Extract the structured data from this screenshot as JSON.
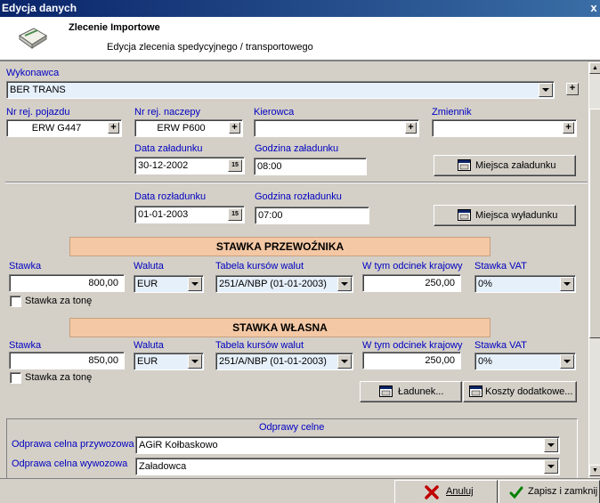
{
  "window": {
    "title": "Edycja danych",
    "close_glyph": "x"
  },
  "header": {
    "title": "Zlecenie Importowe",
    "subtitle": "Edycja zlecenia spedycyjnego / transportowego",
    "icon": "envelope-icon"
  },
  "wykonawca": {
    "label": "Wykonawca",
    "value": "BER TRANS"
  },
  "vehicle": {
    "nr_rej_pojazdu_label": "Nr rej. pojazdu",
    "nr_rej_pojazdu": "ERW G447",
    "nr_rej_naczepy_label": "Nr rej. naczepy",
    "nr_rej_naczepy": "ERW P600",
    "kierowca_label": "Kierowca",
    "kierowca": "",
    "zmiennik_label": "Zmiennik",
    "zmiennik": ""
  },
  "zaladunek": {
    "data_label": "Data załadunku",
    "data": "30-12-2002",
    "godzina_label": "Godzina załadunku",
    "godzina": "08:00",
    "button": "Miejsca załadunku"
  },
  "rozladunek": {
    "data_label": "Data rozładunku",
    "data": "01-01-2003",
    "godzina_label": "Godzina rozładunku",
    "godzina": "07:00",
    "button": "Miejsca wyładunku"
  },
  "calendar_glyph": "15",
  "plus_glyph": "+",
  "stawka_przewoznika": {
    "title": "STAWKA PRZEWOŹNIKA",
    "stawka_label": "Stawka",
    "stawka": "800,00",
    "waluta_label": "Waluta",
    "waluta": "EUR",
    "tabela_label": "Tabela kursów walut",
    "tabela": "251/A/NBP (01-01-2003)",
    "odcinek_label": "W tym odcinek krajowy",
    "odcinek": "250,00",
    "vat_label": "Stawka VAT",
    "vat": "0%",
    "za_tone_label": "Stawka za tonę"
  },
  "stawka_wlasna": {
    "title": "STAWKA WŁASNA",
    "stawka_label": "Stawka",
    "stawka": "850,00",
    "waluta_label": "Waluta",
    "waluta": "EUR",
    "tabela_label": "Tabela kursów walut",
    "tabela": "251/A/NBP (01-01-2003)",
    "odcinek_label": "W tym odcinek krajowy",
    "odcinek": "250,00",
    "vat_label": "Stawka VAT",
    "vat": "0%",
    "za_tone_label": "Stawka za tonę"
  },
  "buttons": {
    "ladunek": "Ładunek...",
    "koszty": "Koszty dodatkowe..."
  },
  "odprawy": {
    "title": "Odprawy celne",
    "przywozowa_label": "Odprawa celna przywozowa",
    "przywozowa": "AGiR Kołbaskowo",
    "wywozowa_label": "Odprawa celna wywozowa",
    "wywozowa": "Załadowca"
  },
  "footer": {
    "anuluj": "Anuluj",
    "zapisz": "Zapisz i zamknij"
  },
  "colors": {
    "label_blue": "#0000c0",
    "section_bar": "#f4c8a4",
    "titlebar": "#0a246a"
  }
}
